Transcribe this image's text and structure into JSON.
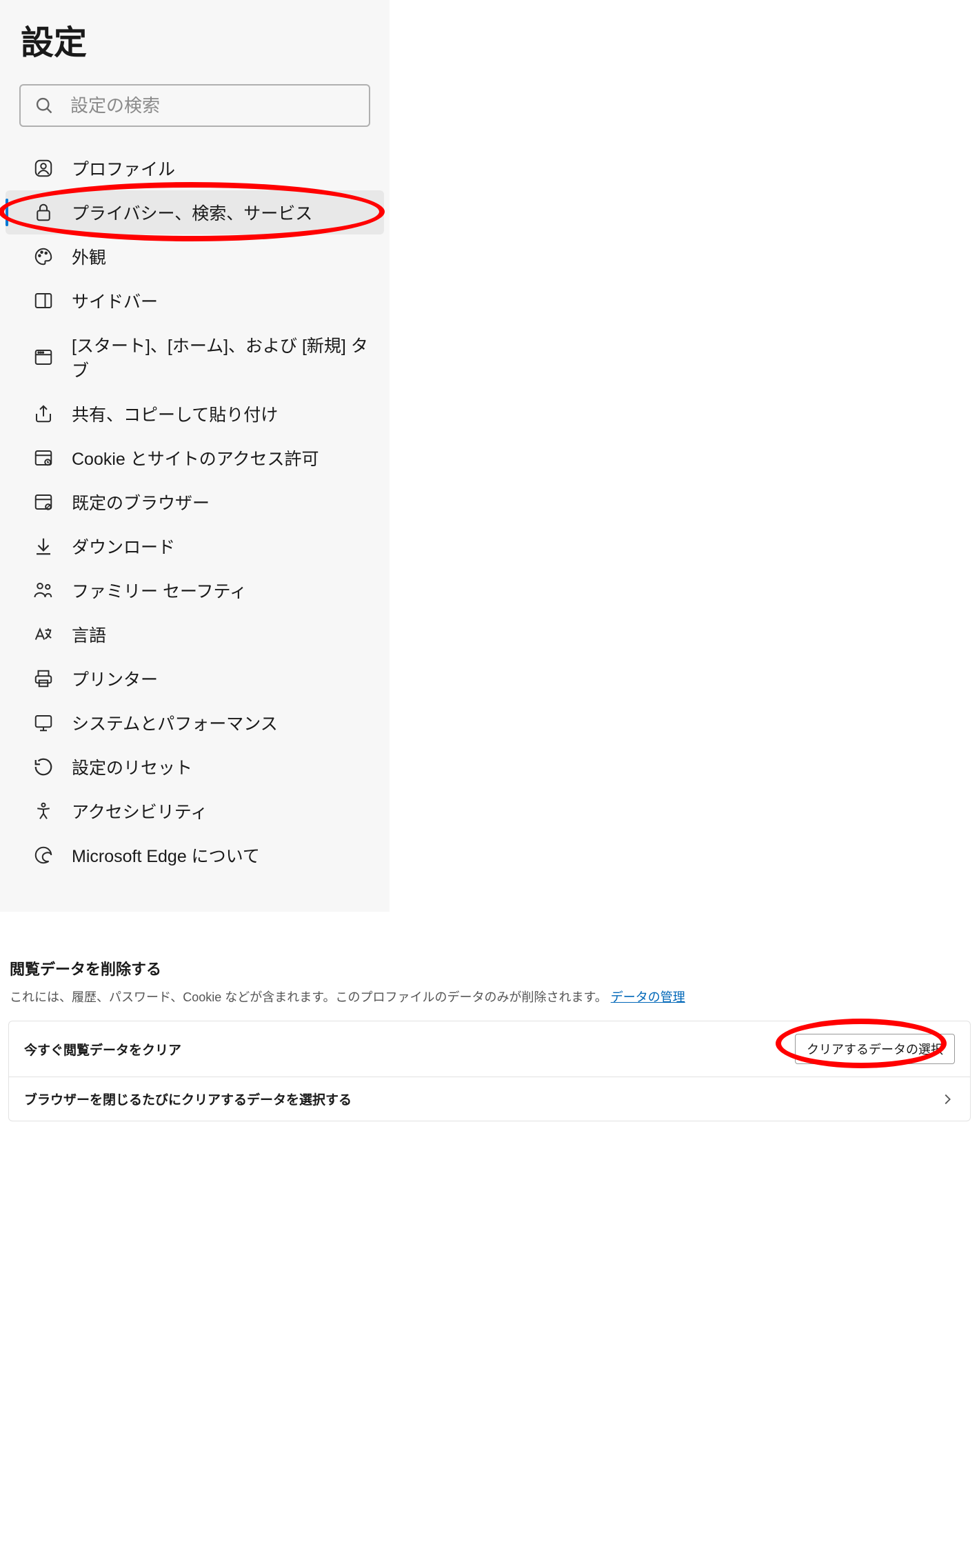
{
  "page_title": "設定",
  "search": {
    "placeholder": "設定の検索"
  },
  "nav": {
    "items": [
      {
        "id": "profile",
        "label": "プロファイル",
        "icon": "profile-icon",
        "selected": false
      },
      {
        "id": "privacy",
        "label": "プライバシー、検索、サービス",
        "icon": "lock-icon",
        "selected": true
      },
      {
        "id": "appearance",
        "label": "外観",
        "icon": "palette-icon",
        "selected": false
      },
      {
        "id": "sidebar",
        "label": "サイドバー",
        "icon": "sidebar-icon",
        "selected": false
      },
      {
        "id": "start",
        "label": "[スタート]、[ホーム]、および [新規] タブ",
        "icon": "window-icon",
        "selected": false
      },
      {
        "id": "share",
        "label": "共有、コピーして貼り付け",
        "icon": "share-icon",
        "selected": false
      },
      {
        "id": "cookies",
        "label": "Cookie とサイトのアクセス許可",
        "icon": "cookie-icon",
        "selected": false
      },
      {
        "id": "default",
        "label": "既定のブラウザー",
        "icon": "browser-icon",
        "selected": false
      },
      {
        "id": "downloads",
        "label": "ダウンロード",
        "icon": "download-icon",
        "selected": false
      },
      {
        "id": "family",
        "label": "ファミリー セーフティ",
        "icon": "family-icon",
        "selected": false
      },
      {
        "id": "languages",
        "label": "言語",
        "icon": "language-icon",
        "selected": false
      },
      {
        "id": "printers",
        "label": "プリンター",
        "icon": "printer-icon",
        "selected": false
      },
      {
        "id": "system",
        "label": "システムとパフォーマンス",
        "icon": "system-icon",
        "selected": false
      },
      {
        "id": "reset",
        "label": "設定のリセット",
        "icon": "reset-icon",
        "selected": false
      },
      {
        "id": "accessibility",
        "label": "アクセシビリティ",
        "icon": "accessibility-icon",
        "selected": false
      },
      {
        "id": "about",
        "label": "Microsoft Edge について",
        "icon": "edge-icon",
        "selected": false
      }
    ]
  },
  "section": {
    "title": "閲覧データを削除する",
    "descriptionPrefix": "これには、履歴、パスワード、Cookie などが含まれます。このプロファイルのデータのみが削除されます。",
    "descriptionLink": "データの管理",
    "rows": [
      {
        "label": "今すぐ閲覧データをクリア",
        "buttonLabel": "クリアするデータの選択"
      },
      {
        "label": "ブラウザーを閉じるたびにクリアするデータを選択する"
      }
    ]
  }
}
